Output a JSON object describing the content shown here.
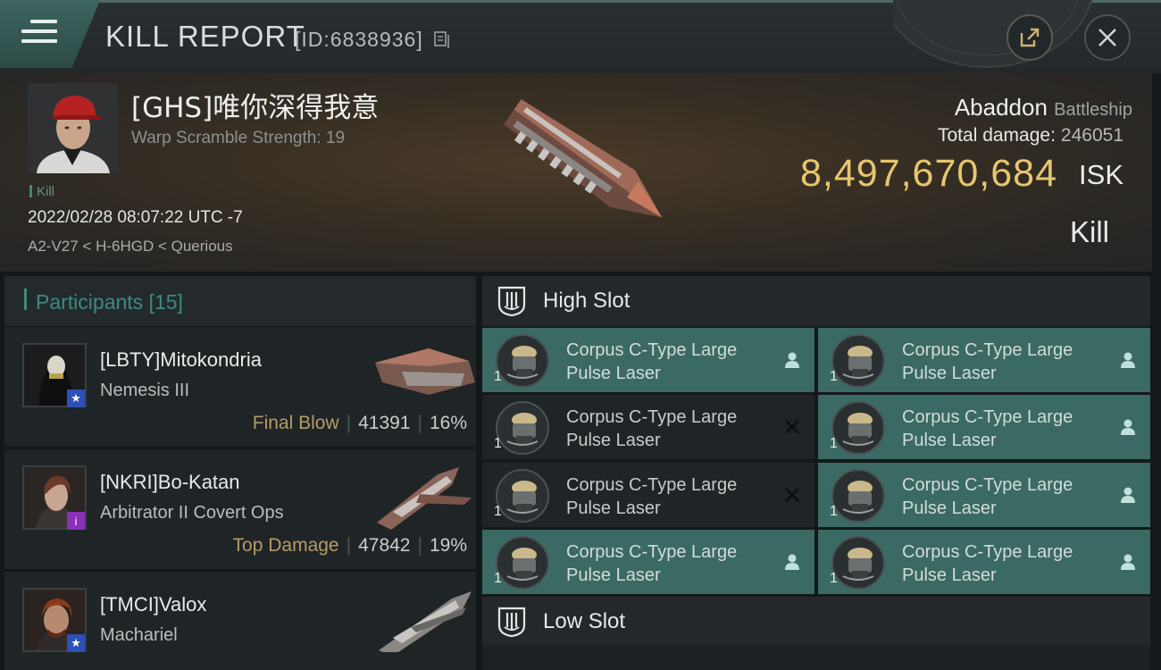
{
  "header": {
    "title": "KILL REPORT",
    "report_id": "[ID:6838936]",
    "icons": [
      "menu-icon",
      "copy-icon",
      "share-icon",
      "close-icon"
    ]
  },
  "victim": {
    "name": "[GHS]唯你深得我意",
    "warp_scramble": "Warp Scramble Strength: 19",
    "kill_tag": "Kill",
    "datetime": "2022/02/28 08:07:22 UTC -7",
    "location": "A2-V27 < H-6HGD < Querious",
    "ship_name": "Abaddon",
    "ship_class": "Battleship",
    "total_damage_label": "Total damage:",
    "total_damage": "246051",
    "isk_value": "8,497,670,684",
    "isk_unit": "ISK",
    "result": "Kill"
  },
  "participants": {
    "title": "Participants",
    "count": "[15]",
    "list": [
      {
        "name": "[LBTY]Mitokondria",
        "ship": "Nemesis III",
        "tag": "Final Blow",
        "damage": "41391",
        "percent": "16%",
        "badge": "star"
      },
      {
        "name": "[NKRI]Bo-Katan",
        "ship": "Arbitrator II Covert Ops",
        "tag": "Top Damage",
        "damage": "47842",
        "percent": "19%",
        "badge": "info"
      },
      {
        "name": "[TMCI]Valox",
        "ship": "Machariel",
        "tag": "",
        "damage": "",
        "percent": "",
        "badge": "star"
      }
    ]
  },
  "modules": {
    "high_slot_label": "High Slot",
    "low_slot_label": "Low Slot",
    "high": [
      {
        "name": "Corpus C-Type Large Pulse Laser",
        "qty": "1",
        "state": "dropped"
      },
      {
        "name": "Corpus C-Type Large Pulse Laser",
        "qty": "1",
        "state": "dropped"
      },
      {
        "name": "Corpus C-Type Large Pulse Laser",
        "qty": "1",
        "state": "destroyed"
      },
      {
        "name": "Corpus C-Type Large Pulse Laser",
        "qty": "1",
        "state": "dropped"
      },
      {
        "name": "Corpus C-Type Large Pulse Laser",
        "qty": "1",
        "state": "destroyed"
      },
      {
        "name": "Corpus C-Type Large Pulse Laser",
        "qty": "1",
        "state": "dropped"
      },
      {
        "name": "Corpus C-Type Large Pulse Laser",
        "qty": "1",
        "state": "dropped"
      },
      {
        "name": "Corpus C-Type Large Pulse Laser",
        "qty": "1",
        "state": "dropped"
      }
    ]
  },
  "colors": {
    "accent_teal": "#3f8a7d",
    "isk_gold": "#e8c66e",
    "tag_gold": "#b59c66",
    "active_module": "#3a6a63"
  }
}
